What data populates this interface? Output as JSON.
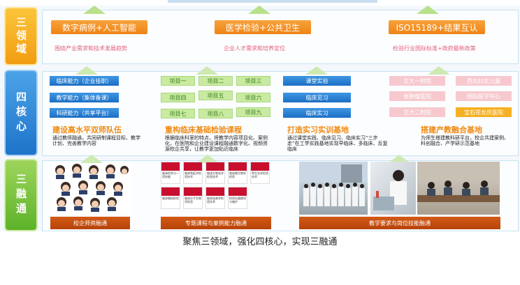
{
  "left_labels": {
    "domains": "三领域",
    "cores": "四核心",
    "fusions": "三融通"
  },
  "domains": [
    {
      "title": "数字病例+人工智能",
      "desc": "围绕产业需求和技术发展趋势"
    },
    {
      "title": "医学检验+公共卫生",
      "desc": "企业人才需求和培养定位"
    },
    {
      "title": "ISO15189+结果互认",
      "desc": "检验行业国际标准+政府最新政策"
    }
  ],
  "cores": {
    "abilities": [
      "临床能力（企业挂职）",
      "教学能力（集体备课）",
      "科研能力（共享平台）"
    ],
    "projects": [
      "项目一",
      "项目二",
      "项目三",
      "项目四",
      "项目五",
      "项目六",
      "项目七",
      "项目八",
      "项目九"
    ],
    "practice": [
      "课堂实验",
      "临床见习",
      "临床实习"
    ],
    "hospitals": [
      "交大一附院",
      "西北妇女儿童",
      "省肿瘤医院",
      "国际医学中心",
      "交大二附院",
      "宝石花长庆医院"
    ],
    "headings": [
      "建设高水平双师队伍",
      "重构临床基础检验课程",
      "打造实习实训基地",
      "搭建产教融合基地"
    ],
    "descs": [
      "通过教师融通，共同研制课程目标、教学计划、完善教学内容",
      "根据临床科室的特点，将教学内容项目化、案例化，在医院和企业建设课程融通数字化、视频资源校企共享，让教学更加贴近临床",
      "通过课堂实践、临床见习、临床实习“三步走”在工学实践基地实现早临床、多临床、反复临床",
      "为师生搭建教科研平台，校企共建案例、科创融合、产学研示范基地"
    ]
  },
  "fusions": {
    "captions": [
      "校企师资融通",
      "专题课程与案例能力融通",
      "教学要求与岗位技能融通"
    ],
    "cards": [
      "临床检验与一项技能",
      "临床免疫学检验技术",
      "临床生物化学检验技术",
      "临床微生物学检验",
      "寄生虫学检验技术",
      "临床输血检验",
      "临床分子生物学检验",
      "临床血液学检验技术",
      "检验仪器使用与维护"
    ]
  },
  "footer": "聚焦三领域，强化四核心，实现三融通",
  "colors": {
    "orange": "#f08a12",
    "blue": "#1d74c9",
    "green": "#5db22a",
    "pink": "#e3607a"
  }
}
